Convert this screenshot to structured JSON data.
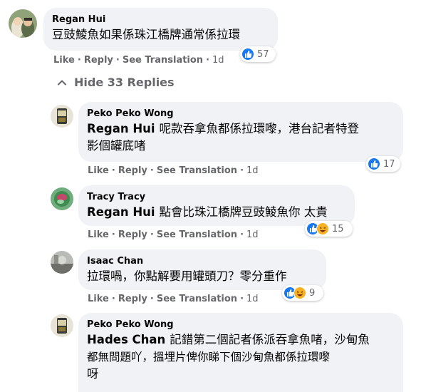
{
  "top_comment": {
    "author": "Regan Hui",
    "text": "豆豉鯪魚如果係珠江橋牌通常係拉環",
    "actions": {
      "like": "Like",
      "reply": "Reply",
      "see_translation": "See Translation",
      "time": "1d"
    },
    "reaction_count": "57"
  },
  "hide_replies_label": "Hide 33 Replies",
  "replies": [
    {
      "author": "Peko Peko Wong",
      "mention": "Regan Hui",
      "text_line1": "呢款吞拿魚都係拉環嚟，港台記者特登",
      "text_line2": "影個罐底啫",
      "actions": {
        "like": "Like",
        "reply": "Reply",
        "see_translation": "See Translation",
        "time": "1d"
      },
      "reaction_count": "17"
    },
    {
      "author": "Tracy Tracy",
      "mention": "Regan Hui",
      "text_line1": "點會比珠江橋牌豆豉鯪魚你 太貴",
      "actions": {
        "like": "Like",
        "reply": "Reply",
        "see_translation": "See Translation",
        "time": "1d"
      },
      "reaction_count": "15"
    },
    {
      "author": "Isaac Chan",
      "text_line1": "拉環喎，你點解要用罐頭刀？零分重作",
      "actions": {
        "like": "Like",
        "reply": "Reply",
        "see_translation": "See Translation",
        "time": "1d"
      },
      "reaction_count": "9"
    },
    {
      "author": "Peko Peko Wong",
      "mention": "Hades Chan",
      "text_line1": "記錯第二個記者係派吞拿魚啫，沙甸魚",
      "text_line2": "都無問題吖，搵埋片俾你睇下個沙甸魚都係拉環嚟",
      "text_line3": "呀"
    }
  ],
  "colors": {
    "bubble": "#f0f2f5",
    "meta": "#65676b",
    "like_blue": "#1877f2",
    "haha_yellow": "#f7b125"
  }
}
